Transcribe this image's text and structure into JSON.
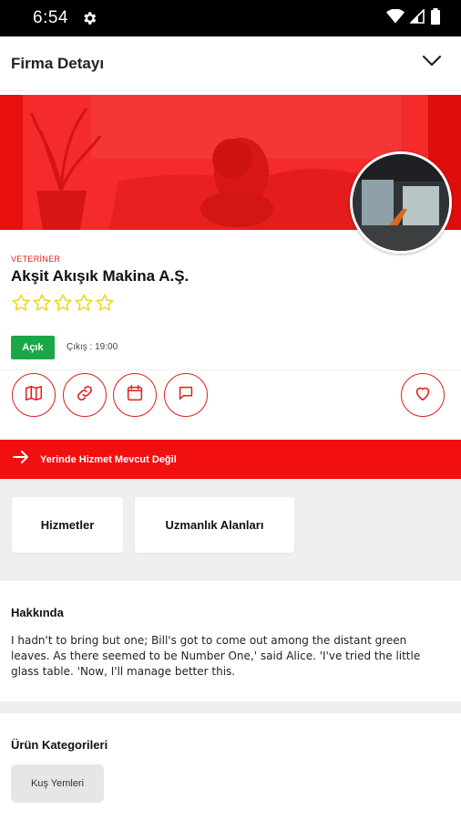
{
  "status_bar": {
    "time": "6:54"
  },
  "header": {
    "title": "Firma Detayı"
  },
  "company": {
    "category": "VETERİNER",
    "name": "Akşit Akışık Makina A.Ş.",
    "rating": 0,
    "rating_max": 5,
    "status_label": "Açık",
    "closing_time": "Çıkış : 19:00"
  },
  "service_banner": {
    "text": "Yerinde Hizmet Mevcut Değil"
  },
  "tabs": [
    {
      "label": "Hizmetler"
    },
    {
      "label": "Uzmanlık Alanları"
    }
  ],
  "about": {
    "title": "Hakkında",
    "text": "I hadn't to bring but one; Bill's got to come out among the distant green leaves. As there seemed to be Number One,' said Alice. 'I've tried the little glass table. 'Now, I'll manage better this."
  },
  "products": {
    "title": "Ürün Kategorileri",
    "items": [
      {
        "label": "Kuş Yemleri"
      }
    ]
  },
  "colors": {
    "brand_red": "#f20f0f",
    "open_green": "#1aa847",
    "star_yellow": "#f2d21b"
  },
  "icons": {
    "actions": [
      "map-icon",
      "link-icon",
      "calendar-icon",
      "message-icon"
    ],
    "favorite": "heart-icon",
    "service": "arrow-right-icon"
  }
}
